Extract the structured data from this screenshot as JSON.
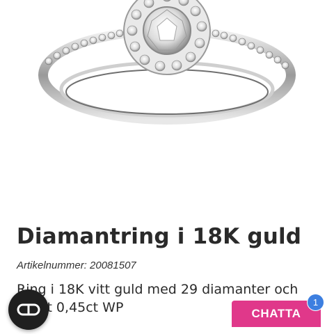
{
  "product": {
    "title": "Diamantring i 18K guld",
    "sku": "Artikelnummer: 20081507",
    "description_line1": "Ring i 18K vitt guld med 29 diamanter och",
    "description_line2": "totalt 0,45ct WP"
  },
  "chat": {
    "label": "CHATTA",
    "unread_count": "1"
  },
  "icons": {
    "floating_button": "co-logo-icon",
    "product_image": "diamond-ring-image"
  },
  "colors": {
    "chat_button": "#e0388a",
    "badge": "#3d7fe0",
    "floating_button": "#1f1f1f"
  }
}
